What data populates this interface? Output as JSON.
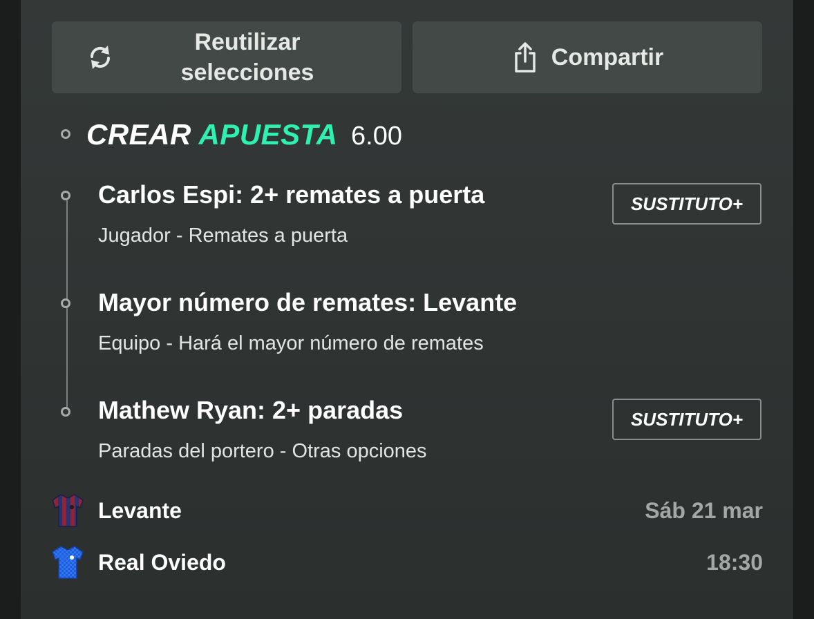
{
  "actions": {
    "reuse_label_line1": "Reutilizar",
    "reuse_label_line2": "selecciones",
    "share_label": "Compartir"
  },
  "bet": {
    "brand_word1": "CREAR",
    "brand_word2": "APUESTA",
    "odds": "6.00",
    "selections": [
      {
        "title": "Carlos Espi: 2+ remates a puerta",
        "subtitle": "Jugador - Remates a puerta",
        "badge": "SUSTITUTO+"
      },
      {
        "title": "Mayor número de remates: Levante",
        "subtitle": "Equipo - Hará el mayor número de remates"
      },
      {
        "title": "Mathew Ryan: 2+ paradas",
        "subtitle": "Paradas del portero - Otras opciones",
        "badge": "SUSTITUTO+"
      }
    ]
  },
  "match": {
    "home_team": "Levante",
    "away_team": "Real Oviedo",
    "date": "Sáb 21 mar",
    "time": "18:30"
  },
  "colors": {
    "accent": "#2ef0b0",
    "card_bg": "#343938",
    "button_bg": "#434947"
  },
  "icons": {
    "reuse": "refresh-icon",
    "share": "share-icon",
    "home_shirt": "levante-shirt-icon",
    "away_shirt": "oviedo-shirt-icon"
  }
}
